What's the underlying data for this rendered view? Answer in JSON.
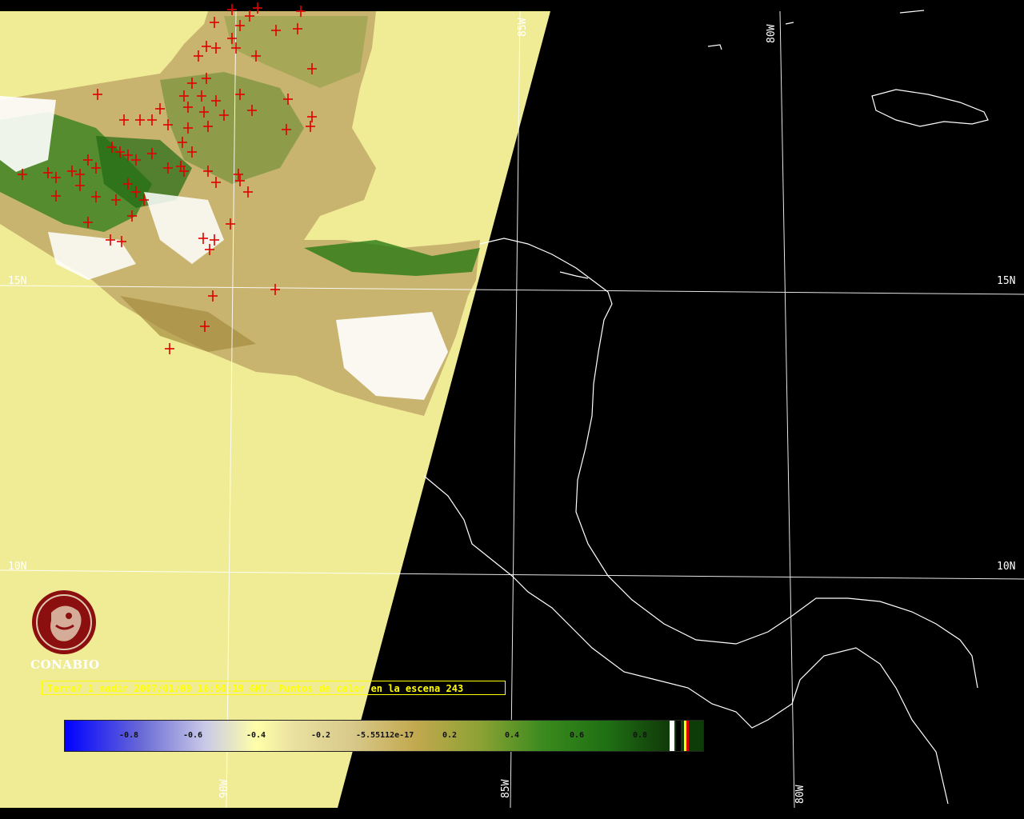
{
  "map": {
    "grid_labels": {
      "lat_15n_left": "15N",
      "lat_15n_right": "15N",
      "lat_10n_left": "10N",
      "lat_10n_right": "10N",
      "lon_85w_top": "85W",
      "lon_80w_top": "80W",
      "lon_90w_bottom": "90W",
      "lon_85w_bottom": "85W",
      "lon_80w_bottom": "80W"
    },
    "colors": {
      "background": "#000000",
      "swath_fill": "#f0ec96",
      "coastline": "#ffffff",
      "fire_marker": "#e00000",
      "vegetation_dark": "#2c7a18",
      "vegetation_light": "#bfa456"
    }
  },
  "caption": "Terra? 1 nadir 2007/01/09 16:50:19 GMT. Puntos de calor en la escena 243",
  "colorbar": {
    "ticks": [
      "-0.8",
      "-0.6",
      "-0.4",
      "-0.2",
      "-5.55112e-17",
      "0.2",
      "0.4",
      "0.6",
      "0.8"
    ]
  },
  "logo": {
    "text": "CONABIO",
    "color": "#8b0f0f"
  }
}
